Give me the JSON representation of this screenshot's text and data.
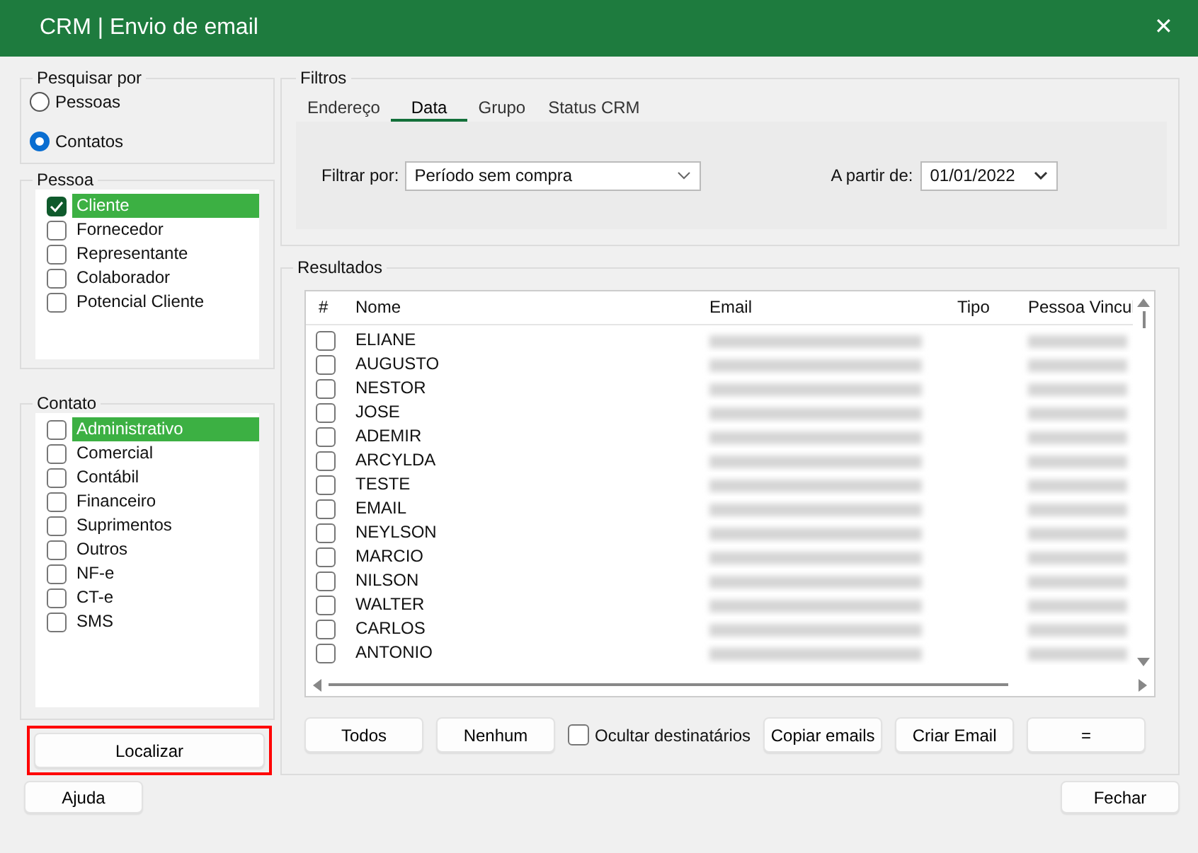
{
  "window": {
    "title": "CRM | Envio de email",
    "close": "✕"
  },
  "search_by": {
    "legend": "Pesquisar por",
    "options": [
      {
        "label": "Pessoas",
        "selected": false
      },
      {
        "label": "Contatos",
        "selected": true
      }
    ]
  },
  "pessoa": {
    "legend": "Pessoa",
    "items": [
      {
        "label": "Cliente",
        "checked": true,
        "selected": true
      },
      {
        "label": "Fornecedor",
        "checked": false,
        "selected": false
      },
      {
        "label": "Representante",
        "checked": false,
        "selected": false
      },
      {
        "label": "Colaborador",
        "checked": false,
        "selected": false
      },
      {
        "label": "Potencial Cliente",
        "checked": false,
        "selected": false
      }
    ]
  },
  "contato": {
    "legend": "Contato",
    "items": [
      {
        "label": "Administrativo",
        "checked": false,
        "selected": true
      },
      {
        "label": "Comercial",
        "checked": false,
        "selected": false
      },
      {
        "label": "Contábil",
        "checked": false,
        "selected": false
      },
      {
        "label": "Financeiro",
        "checked": false,
        "selected": false
      },
      {
        "label": "Suprimentos",
        "checked": false,
        "selected": false
      },
      {
        "label": "Outros",
        "checked": false,
        "selected": false
      },
      {
        "label": "NF-e",
        "checked": false,
        "selected": false
      },
      {
        "label": "CT-e",
        "checked": false,
        "selected": false
      },
      {
        "label": "SMS",
        "checked": false,
        "selected": false
      }
    ]
  },
  "locate_button": {
    "label": "Localizar",
    "highlighted": true
  },
  "filters": {
    "legend": "Filtros",
    "tabs": [
      {
        "label": "Endereço",
        "selected": false
      },
      {
        "label": "Data",
        "selected": true
      },
      {
        "label": "Grupo",
        "selected": false
      },
      {
        "label": "Status CRM",
        "selected": false
      }
    ],
    "filter_by": {
      "label": "Filtrar por:",
      "value": "Período sem compra"
    },
    "from": {
      "label": "A partir de:",
      "value": "01/01/2022"
    }
  },
  "results": {
    "legend": "Resultados",
    "columns": [
      "#",
      "Nome",
      "Email",
      "Tipo",
      "Pessoa Vincul"
    ],
    "rows": [
      {
        "checked": false,
        "name": "ELIANE",
        "email_blurred": true,
        "pessoa_blurred": true
      },
      {
        "checked": false,
        "name": "AUGUSTO",
        "email_blurred": true,
        "pessoa_blurred": true
      },
      {
        "checked": false,
        "name": "NESTOR",
        "email_blurred": true,
        "pessoa_blurred": true
      },
      {
        "checked": false,
        "name": "JOSE",
        "email_blurred": true,
        "pessoa_blurred": true
      },
      {
        "checked": false,
        "name": "ADEMIR",
        "email_blurred": true,
        "pessoa_blurred": true
      },
      {
        "checked": false,
        "name": "ARCYLDA",
        "email_blurred": true,
        "pessoa_blurred": true
      },
      {
        "checked": false,
        "name": "TESTE",
        "email_blurred": true,
        "pessoa_blurred": true
      },
      {
        "checked": false,
        "name": "EMAIL",
        "email_blurred": true,
        "pessoa_blurred": true
      },
      {
        "checked": false,
        "name": "NEYLSON",
        "email_blurred": true,
        "pessoa_blurred": true
      },
      {
        "checked": false,
        "name": "MARCIO",
        "email_blurred": true,
        "pessoa_blurred": true
      },
      {
        "checked": false,
        "name": "NILSON",
        "email_blurred": true,
        "pessoa_blurred": true
      },
      {
        "checked": false,
        "name": "WALTER",
        "email_blurred": true,
        "pessoa_blurred": true
      },
      {
        "checked": false,
        "name": "CARLOS",
        "email_blurred": true,
        "pessoa_blurred": true
      },
      {
        "checked": false,
        "name": "ANTONIO",
        "email_blurred": true,
        "pessoa_blurred": true
      }
    ],
    "buttons": [
      {
        "kind": "button",
        "label": "Todos"
      },
      {
        "kind": "button",
        "label": "Nenhum"
      },
      {
        "kind": "checkbox",
        "label": "Ocultar destinatários",
        "checked": false
      },
      {
        "kind": "button",
        "label": "Copiar emails"
      },
      {
        "kind": "button",
        "label": "Criar Email"
      },
      {
        "kind": "button",
        "label": "="
      }
    ]
  },
  "footer": {
    "help": "Ajuda",
    "close": "Fechar"
  }
}
